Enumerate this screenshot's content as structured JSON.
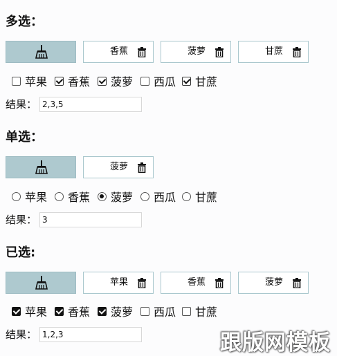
{
  "sections": [
    {
      "title": "多选：",
      "tags": [
        "香蕉",
        "菠萝",
        "甘蔗"
      ],
      "options": [
        {
          "label": "苹果",
          "checked": false
        },
        {
          "label": "香蕉",
          "checked": true
        },
        {
          "label": "菠萝",
          "checked": true
        },
        {
          "label": "西瓜",
          "checked": false
        },
        {
          "label": "甘蔗",
          "checked": true
        }
      ],
      "result_label": "结果：",
      "result_value": "2,3,5"
    },
    {
      "title": "单选：",
      "tags": [
        "菠萝"
      ],
      "options": [
        {
          "label": "苹果",
          "checked": false
        },
        {
          "label": "香蕉",
          "checked": false
        },
        {
          "label": "菠萝",
          "checked": true
        },
        {
          "label": "西瓜",
          "checked": false
        },
        {
          "label": "甘蔗",
          "checked": false
        }
      ],
      "result_label": "结果：",
      "result_value": "3"
    },
    {
      "title": "已选:",
      "tags": [
        "苹果",
        "香蕉",
        "菠萝"
      ],
      "options": [
        {
          "label": "苹果",
          "checked": true
        },
        {
          "label": "香蕉",
          "checked": true
        },
        {
          "label": "菠萝",
          "checked": true
        },
        {
          "label": "西瓜",
          "checked": false
        },
        {
          "label": "甘蔗",
          "checked": false
        }
      ],
      "result_label": "结果：",
      "result_value": "1,2,3"
    }
  ],
  "icons": {
    "clear": "broom-icon",
    "delete": "trash-icon"
  },
  "colors": {
    "clear_button": "#aec9cf",
    "tag_border": "#a9c7cd"
  },
  "watermark": "跟版网模板"
}
